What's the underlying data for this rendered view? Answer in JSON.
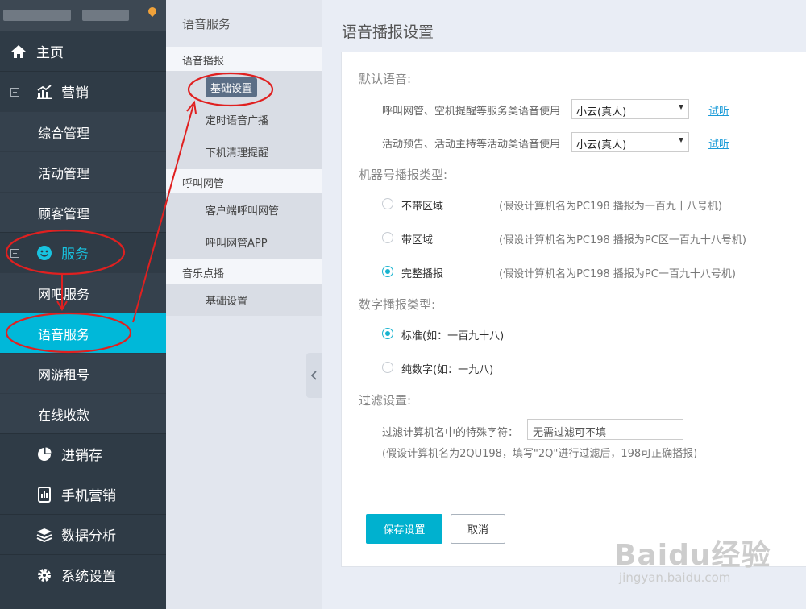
{
  "sidebar": {
    "items": [
      {
        "label": "主页",
        "icon": "home-icon"
      },
      {
        "label": "营销",
        "icon": "chart-icon"
      },
      {
        "label": "服务",
        "icon": "smile-icon"
      },
      {
        "label": "进销存",
        "icon": "pie-icon"
      },
      {
        "label": "手机营销",
        "icon": "phone-icon"
      },
      {
        "label": "数据分析",
        "icon": "layers-icon"
      },
      {
        "label": "系统设置",
        "icon": "gear-icon"
      }
    ],
    "marketing_sub": [
      "综合管理",
      "活动管理",
      "顾客管理"
    ],
    "service_sub": [
      "网吧服务",
      "语音服务",
      "网游租号",
      "在线收款"
    ]
  },
  "subnav": {
    "title": "语音服务",
    "groups": [
      {
        "label": "语音播报",
        "items": [
          "基础设置",
          "定时语音广播",
          "下机清理提醒"
        ]
      },
      {
        "label": "呼叫网管",
        "items": [
          "客户端呼叫网管",
          "呼叫网管APP"
        ]
      },
      {
        "label": "音乐点播",
        "items": [
          "基础设置"
        ]
      }
    ]
  },
  "main": {
    "title": "语音播报设置",
    "default_voice": {
      "heading": "默认语音:",
      "rows": [
        {
          "label": "呼叫网管、空机提醒等服务类语音使用",
          "value": "小云(真人)",
          "link": "试听"
        },
        {
          "label": "活动预告、活动主持等活动类语音使用",
          "value": "小云(真人)",
          "link": "试听"
        }
      ]
    },
    "machine_type": {
      "heading": "机器号播报类型:",
      "options": [
        {
          "label": "不带区域",
          "hint": "(假设计算机名为PC198 播报为一百九十八号机)",
          "selected": false
        },
        {
          "label": "带区域",
          "hint": "(假设计算机名为PC198 播报为PC区一百九十八号机)",
          "selected": false
        },
        {
          "label": "完整播报",
          "hint": "(假设计算机名为PC198 播报为PC一百九十八号机)",
          "selected": true
        }
      ]
    },
    "number_type": {
      "heading": "数字播报类型:",
      "options": [
        {
          "label": "标准(如：一百九十八)",
          "selected": true
        },
        {
          "label": "纯数字(如：一九八)",
          "selected": false
        }
      ]
    },
    "filter": {
      "heading": "过滤设置:",
      "label": "过滤计算机名中的特殊字符：",
      "placeholder": "无需过滤可不填",
      "hint": "(假设计算机名为2QU198，填写\"2Q\"进行过滤后，198可正确播报)"
    },
    "buttons": {
      "save": "保存设置",
      "cancel": "取消"
    }
  },
  "watermark": {
    "big": "Baidu经验",
    "small": "jingyan.baidu.com"
  },
  "colors": {
    "accent": "#00b8d9",
    "sidebar": "#2f3b46",
    "annotation": "#e02020"
  }
}
